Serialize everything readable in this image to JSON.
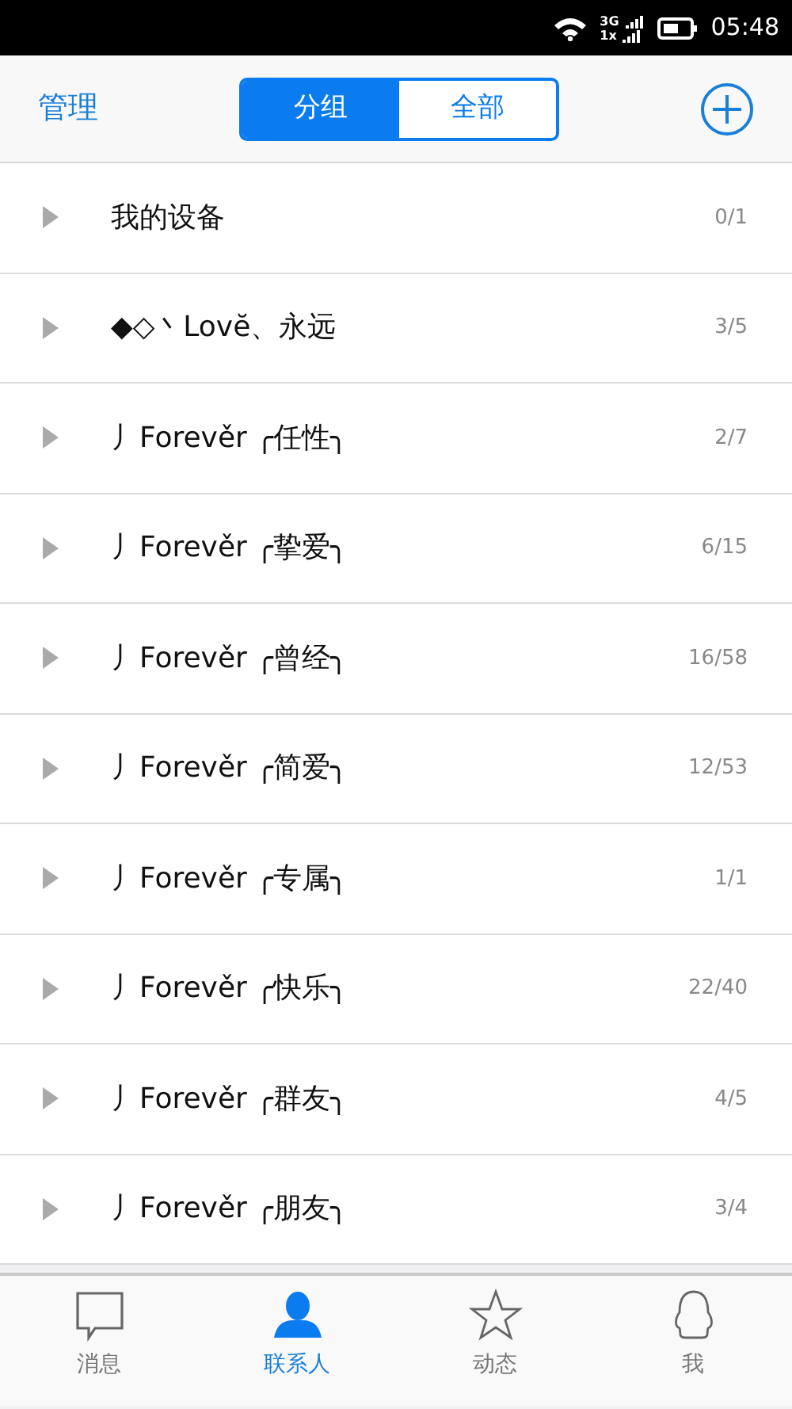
{
  "status_bar": {
    "networks": [
      "3G",
      "1x"
    ],
    "time": "05:48"
  },
  "header": {
    "left": "管理",
    "segments": [
      {
        "label": "分组",
        "selected": true
      },
      {
        "label": "全部",
        "selected": false
      }
    ]
  },
  "groups": [
    {
      "name": "我的设备",
      "count": "0/1",
      "expanded": false
    },
    {
      "name": "◆◇丶Lovĕ、永远",
      "count": "3/5",
      "expanded": false
    },
    {
      "name": "丿Forevěr ╭任性╮",
      "count": "2/7",
      "expanded": false
    },
    {
      "name": "丿Forevěr ╭挚爱╮",
      "count": "6/15",
      "expanded": false
    },
    {
      "name": "丿Forevěr ╭曾经╮",
      "count": "16/58",
      "expanded": false
    },
    {
      "name": "丿Forevěr ╭简爱╮",
      "count": "12/53",
      "expanded": false
    },
    {
      "name": "丿Forevěr ╭专属╮",
      "count": "1/1",
      "expanded": false
    },
    {
      "name": "丿Forevěr ╭快乐╮",
      "count": "22/40",
      "expanded": false
    },
    {
      "name": "丿Forevěr ╭群友╮",
      "count": "4/5",
      "expanded": false
    },
    {
      "name": "丿Forevěr ╭朋友╮",
      "count": "3/4",
      "expanded": false
    }
  ],
  "tab_bar": [
    {
      "kind": "chat",
      "label": "消息",
      "selected": false
    },
    {
      "kind": "contact",
      "label": "联系人",
      "selected": true
    },
    {
      "kind": "star",
      "label": "动态",
      "selected": false
    },
    {
      "kind": "penguin",
      "label": "我",
      "selected": false
    }
  ]
}
